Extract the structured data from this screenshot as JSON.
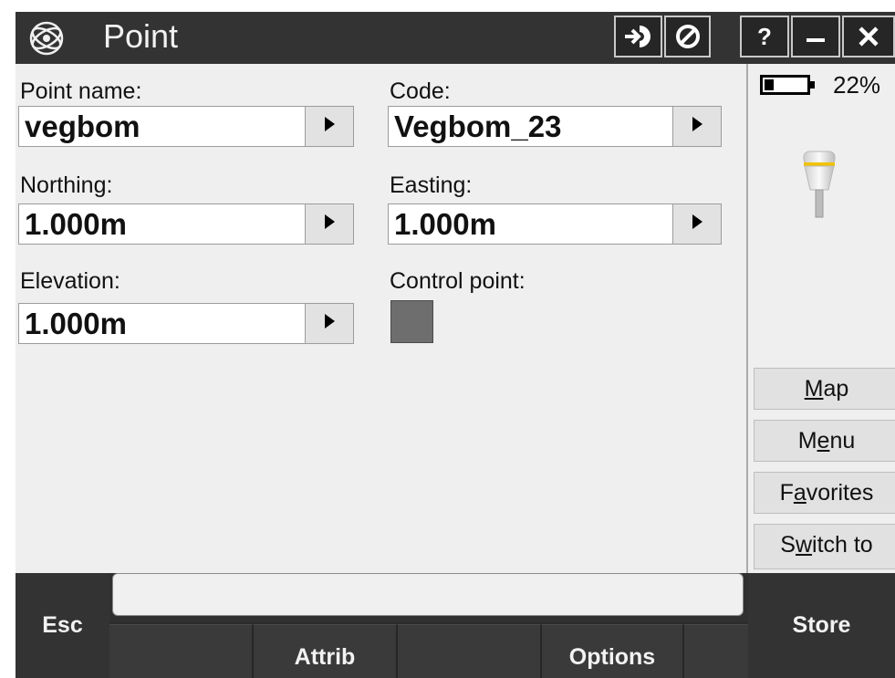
{
  "titlebar": {
    "title": "Point",
    "icons": [
      "trimble-globe-icon",
      "next-form-icon",
      "cancel-form-icon",
      "help-icon",
      "minimize-icon",
      "close-icon"
    ],
    "help_label": "?"
  },
  "form": {
    "point_name": {
      "label": "Point name:",
      "value": "vegbom"
    },
    "code": {
      "label": "Code:",
      "value": "Vegbom_23"
    },
    "northing": {
      "label": "Northing:",
      "value": "1.000m"
    },
    "easting": {
      "label": "Easting:",
      "value": "1.000m"
    },
    "elevation": {
      "label": "Elevation:",
      "value": "1.000m"
    },
    "control_point": {
      "label": "Control point:",
      "checked": false
    }
  },
  "status": {
    "battery_percent": "22%",
    "battery_level": 0.22,
    "receiver_icon": "gnss-receiver-icon"
  },
  "side_menu": {
    "map": {
      "pre": "",
      "key": "M",
      "post": "ap"
    },
    "menu": {
      "pre": "M",
      "key": "e",
      "post": "nu"
    },
    "favorites": {
      "pre": "F",
      "key": "a",
      "post": "vorites"
    },
    "switch_to": {
      "pre": "S",
      "key": "w",
      "post": "itch to"
    }
  },
  "bottom_bar": {
    "esc": "Esc",
    "store": "Store",
    "softkeys": [
      "",
      "Attrib",
      "",
      "Options",
      ""
    ],
    "message": ""
  },
  "colors": {
    "titlebar": "#333333",
    "form_bg": "#efefef",
    "bottom_bar": "#2c2c2c",
    "checkbox": "#6e6e6e",
    "receiver_accent": "#f2c200"
  }
}
